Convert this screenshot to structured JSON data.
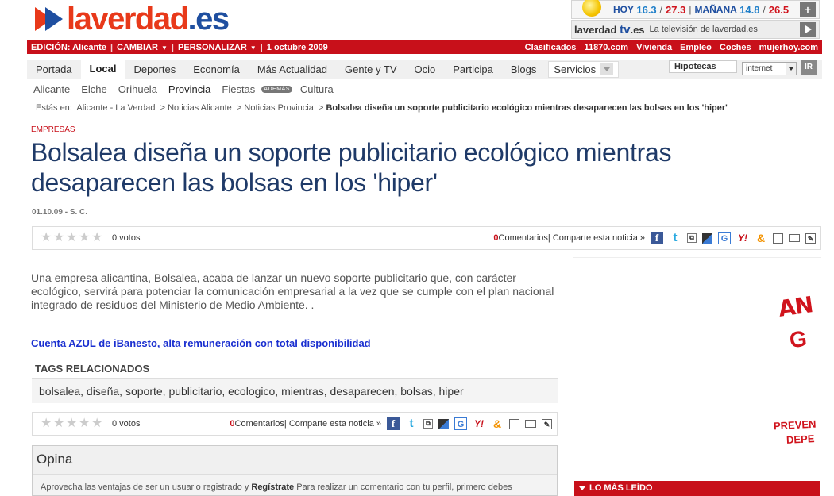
{
  "logo": {
    "name": "laverdad",
    "dot": ".",
    "tld": "es"
  },
  "weather": {
    "today_label": "HOY",
    "today_min": "16.3",
    "today_max": "27.3",
    "tomorrow_label": "MAÑANA",
    "tomorrow_min": "14.8",
    "tomorrow_max": "26.5",
    "sep": "/",
    "divider": "|",
    "plus": "+"
  },
  "tv": {
    "logo_a": "laverdad",
    "logo_b": "tv",
    "logo_c": ".es",
    "text": "La televisión de laverdad.es"
  },
  "topbar": {
    "edition_label": "EDICIÓN:",
    "edition_value": "Alicante",
    "change": "CAMBIAR",
    "personalize": "PERSONALIZAR",
    "date": "1 octubre 2009",
    "right_links": [
      "Clasificados",
      "11870.com",
      "Vivienda",
      "Empleo",
      "Coches",
      "mujerhoy.com"
    ]
  },
  "nav": {
    "items": [
      "Portada",
      "Local",
      "Deportes",
      "Economía",
      "Más Actualidad",
      "Gente y TV",
      "Ocio",
      "Participa",
      "Blogs"
    ],
    "active": "Local",
    "services": "Servicios"
  },
  "search": {
    "field_value": "Hipotecas",
    "select_value": "internet",
    "button": "IR"
  },
  "subnav": {
    "items": [
      "Alicante",
      "Elche",
      "Orihuela",
      "Provincia",
      "Fiestas"
    ],
    "badge": "ADEMÁS",
    "extra": "Cultura",
    "current": "Provincia"
  },
  "breadcrumb": {
    "label": "Estás en:",
    "items": [
      "Alicante - La Verdad",
      "Noticias Alicante",
      "Noticias Provincia"
    ],
    "current": "Bolsalea diseña un soporte publicitario ecológico mientras desaparecen las bolsas en los 'hiper'",
    "sep": ">"
  },
  "article": {
    "section": "EMPRESAS",
    "title": "Bolsalea diseña un soporte publicitario ecológico mientras desaparecen las bolsas en los 'hiper'",
    "meta": "01.10.09 - S. C.",
    "lead": "Una empresa alicantina, Bolsalea, acaba de lanzar un nuevo soporte publicitario que, con carácter ecológico, servirá para potenciar la comunicación empresarial a la vez que se cumple con el plan nacional integrado de residuos del Ministerio de Medio Ambiente. .",
    "ad_link": "Cuenta AZUL de iBanesto, alta remuneración con total disponibilidad"
  },
  "rating": {
    "stars": 5,
    "votes": "0 votos",
    "comments_count": "0",
    "comments_label": " Comentarios",
    "share": " | Comparte esta noticia »"
  },
  "tags": {
    "title": "TAGS RELACIONADOS",
    "list": "bolsalea, diseña, soporte, publicitario, ecologico, mientras, desaparecen, bolsas, hiper"
  },
  "opina": {
    "title": "Opina",
    "text_a": "Aprovecha las ventajas de ser un usuario registrado y ",
    "text_b": "Regístrate",
    "text_c": " Para realizar un comentario con tu perfil, primero debes"
  },
  "sidebar": {
    "ad_lines": [
      "AN",
      "G",
      "PREVEN",
      "DEPE"
    ],
    "most_read": "LO MÁS LEÍDO"
  },
  "colors": {
    "brand_red": "#c8101a",
    "brand_blue": "#1f4fa0",
    "headline": "#1f3a68",
    "link": "#1a2fd0"
  }
}
